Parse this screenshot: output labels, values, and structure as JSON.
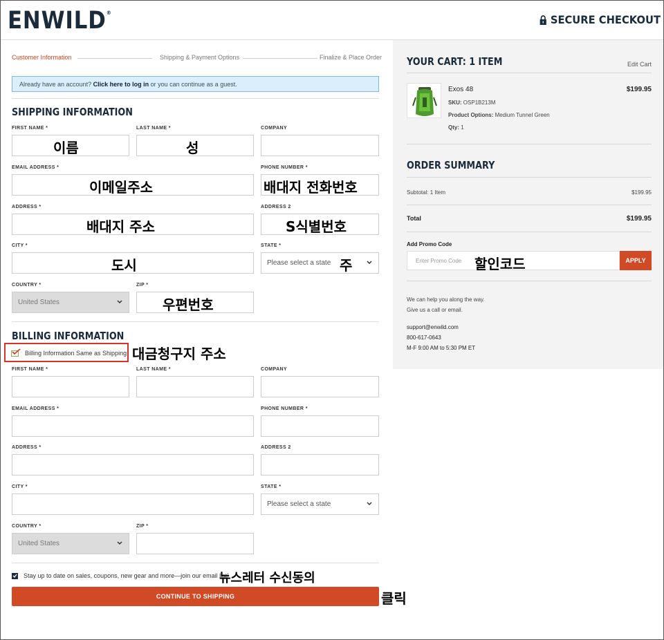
{
  "header": {
    "logo": "ENWILD",
    "logo_mark": "®",
    "secure_label": "SECURE CHECKOUT"
  },
  "steps": [
    "Customer Information",
    "Shipping & Payment Options",
    "Finalize & Place Order"
  ],
  "notice": {
    "prefix": "Already have an account?",
    "link": "Click here to log in",
    "suffix": "or you can continue as a guest."
  },
  "shipping": {
    "title": "SHIPPING INFORMATION",
    "labels": {
      "first_name": "FIRST NAME *",
      "last_name": "LAST NAME *",
      "company": "COMPANY",
      "email": "EMAIL ADDRESS *",
      "phone": "PHONE NUMBER *",
      "address": "ADDRESS *",
      "address2": "ADDRESS 2",
      "city": "CITY *",
      "state": "STATE *",
      "country": "COUNTRY *",
      "zip": "ZIP *"
    },
    "state_value": "Please select a state",
    "country_value": "United States"
  },
  "billing": {
    "title": "BILLING INFORMATION",
    "same_as_shipping": "Billing Information Same as Shipping",
    "labels": {
      "first_name": "FIRST NAME *",
      "last_name": "LAST NAME *",
      "company": "COMPANY",
      "email": "EMAIL ADDRESS *",
      "phone": "PHONE NUMBER *",
      "address": "ADDRESS *",
      "address2": "ADDRESS 2",
      "city": "CITY *",
      "state": "STATE *",
      "country": "COUNTRY *",
      "zip": "ZIP *"
    },
    "state_value": "Please select a state",
    "country_value": "United States"
  },
  "newsletter": "Stay up to date on sales, coupons, new gear and more—join our email list!",
  "continue_label": "CONTINUE TO SHIPPING",
  "annotations": {
    "first_name": "이름",
    "last_name": "성",
    "email": "이메일주소",
    "phone": "배대지 전화번호",
    "address": "배대지 주소",
    "address2": "S식별번호",
    "city": "도시",
    "state": "주",
    "zip": "우편번호",
    "billing": "대금청구지 주소",
    "promo": "할인코드",
    "newsletter": "뉴스레터 수신동의",
    "click": "클릭"
  },
  "cart": {
    "title": "YOUR CART: 1 ITEM",
    "edit": "Edit Cart",
    "item_name": "Exos 48",
    "item_price": "$199.95",
    "sku_label": "SKU:",
    "sku": "OSP1B213M",
    "options_label": "Product Options:",
    "options": "Medium Tunnel Green",
    "qty_label": "Qty:",
    "qty": "1"
  },
  "summary": {
    "title": "ORDER SUMMARY",
    "subtotal_label": "Subtotal: 1 Item",
    "subtotal": "$199.95",
    "total_label": "Total",
    "total": "$199.95",
    "promo_label": "Add Promo Code",
    "promo_placeholder": "Enter Promo Code",
    "apply": "APPLY"
  },
  "help": {
    "line1": "We can help you along the way.",
    "line2": "Give us a call or email.",
    "email": "support@enwild.com",
    "phone": "800-617-0643",
    "hours": "M-F 9:00 AM to 5:30 PM ET"
  },
  "colors": {
    "accent": "#cf4a25",
    "navy": "#1c2b3a",
    "notice_bg": "#dbeefb"
  }
}
